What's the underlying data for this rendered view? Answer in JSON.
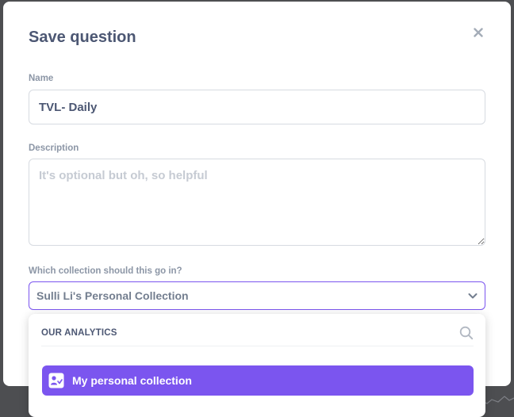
{
  "dialog": {
    "title": "Save question",
    "close_icon": "close-icon"
  },
  "name_field": {
    "label": "Name",
    "value": "TVL- Daily"
  },
  "description_field": {
    "label": "Description",
    "placeholder": "It's optional but oh, so helpful",
    "value": ""
  },
  "collection_field": {
    "label": "Which collection should this go in?",
    "selected": "Sulli Li's Personal Collection",
    "chevron_icon": "chevron-down-icon"
  },
  "collection_picker": {
    "header": "OUR ANALYTICS",
    "search_icon": "search-icon",
    "items": [
      {
        "label": "My personal collection",
        "icon": "person-icon",
        "selected": true
      }
    ]
  },
  "colors": {
    "accent": "#7b55ef",
    "text": "#4c5773",
    "muted": "#8c96a6"
  }
}
